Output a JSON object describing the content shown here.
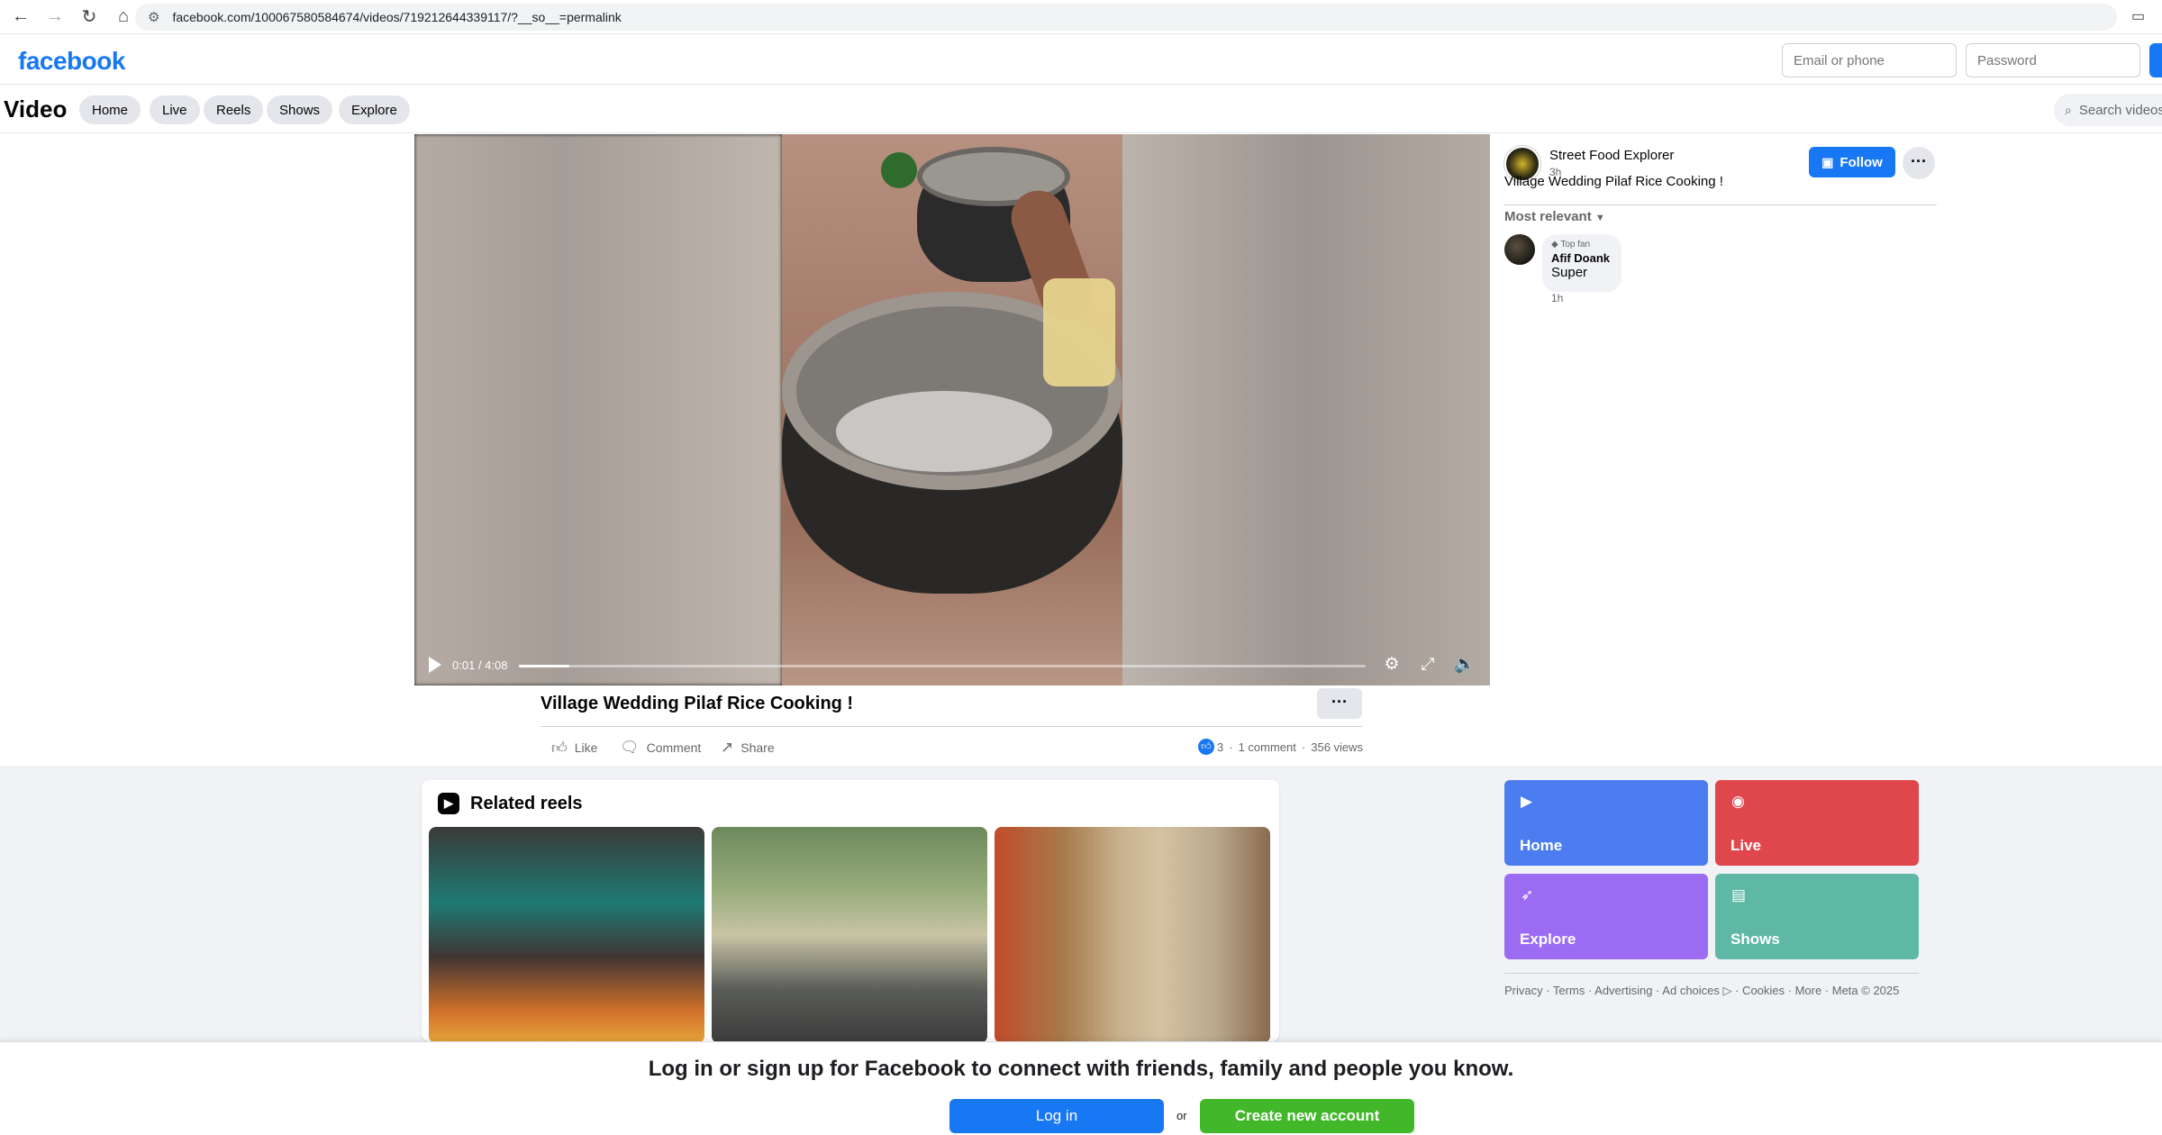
{
  "browser": {
    "url": "facebook.com/100067580584674/videos/719212644339117/?__so__=permalink",
    "icons": [
      "back-icon",
      "forward-icon",
      "reload-icon",
      "home-icon",
      "site-settings-icon",
      "cast-icon"
    ]
  },
  "header": {
    "logo": "facebook",
    "email_placeholder": "Email or phone",
    "password_placeholder": "Password",
    "brand_color": "#1877f2"
  },
  "subnav": {
    "title": "Video",
    "pills": [
      "Home",
      "Live",
      "Reels",
      "Shows",
      "Explore"
    ],
    "search_placeholder": "Search videos"
  },
  "video": {
    "time": "0:01 / 4:08",
    "progress": 0.06
  },
  "post": {
    "title": "Village Wedding Pilaf Rice Cooking !",
    "actions": {
      "like": "Like",
      "comment": "Comment",
      "share": "Share"
    },
    "reactions_count": "3",
    "comments": "1 comment",
    "views": "356 views",
    "separator": "·"
  },
  "author": {
    "name": "Street Food Explorer",
    "time": "3h",
    "caption": "Village Wedding Pilaf Rice Cooking !",
    "follow_label": "Follow"
  },
  "comments_section": {
    "sort_label": "Most relevant",
    "comments": [
      {
        "badge": "Top fan",
        "author": "Afif Doank",
        "text": "Super",
        "time": "1h"
      }
    ]
  },
  "related_reels": {
    "title": "Related reels"
  },
  "tiles": [
    {
      "label": "Home",
      "color": "#4b7df0",
      "icon": "tv-icon"
    },
    {
      "label": "Live",
      "color": "#e0474c",
      "icon": "live-camera-icon"
    },
    {
      "label": "Explore",
      "color": "#9b6cf2",
      "icon": "rocket-icon"
    },
    {
      "label": "Shows",
      "color": "#5fb8a5",
      "icon": "clapper-icon"
    }
  ],
  "footer": {
    "links": "Privacy · Terms · Advertising · Ad choices ▷ · Cookies · More · Meta © 2025"
  },
  "banner": {
    "text": "Log in or sign up for Facebook to connect with friends, family and people you know.",
    "login": "Log in",
    "or": "or",
    "create": "Create new account"
  }
}
